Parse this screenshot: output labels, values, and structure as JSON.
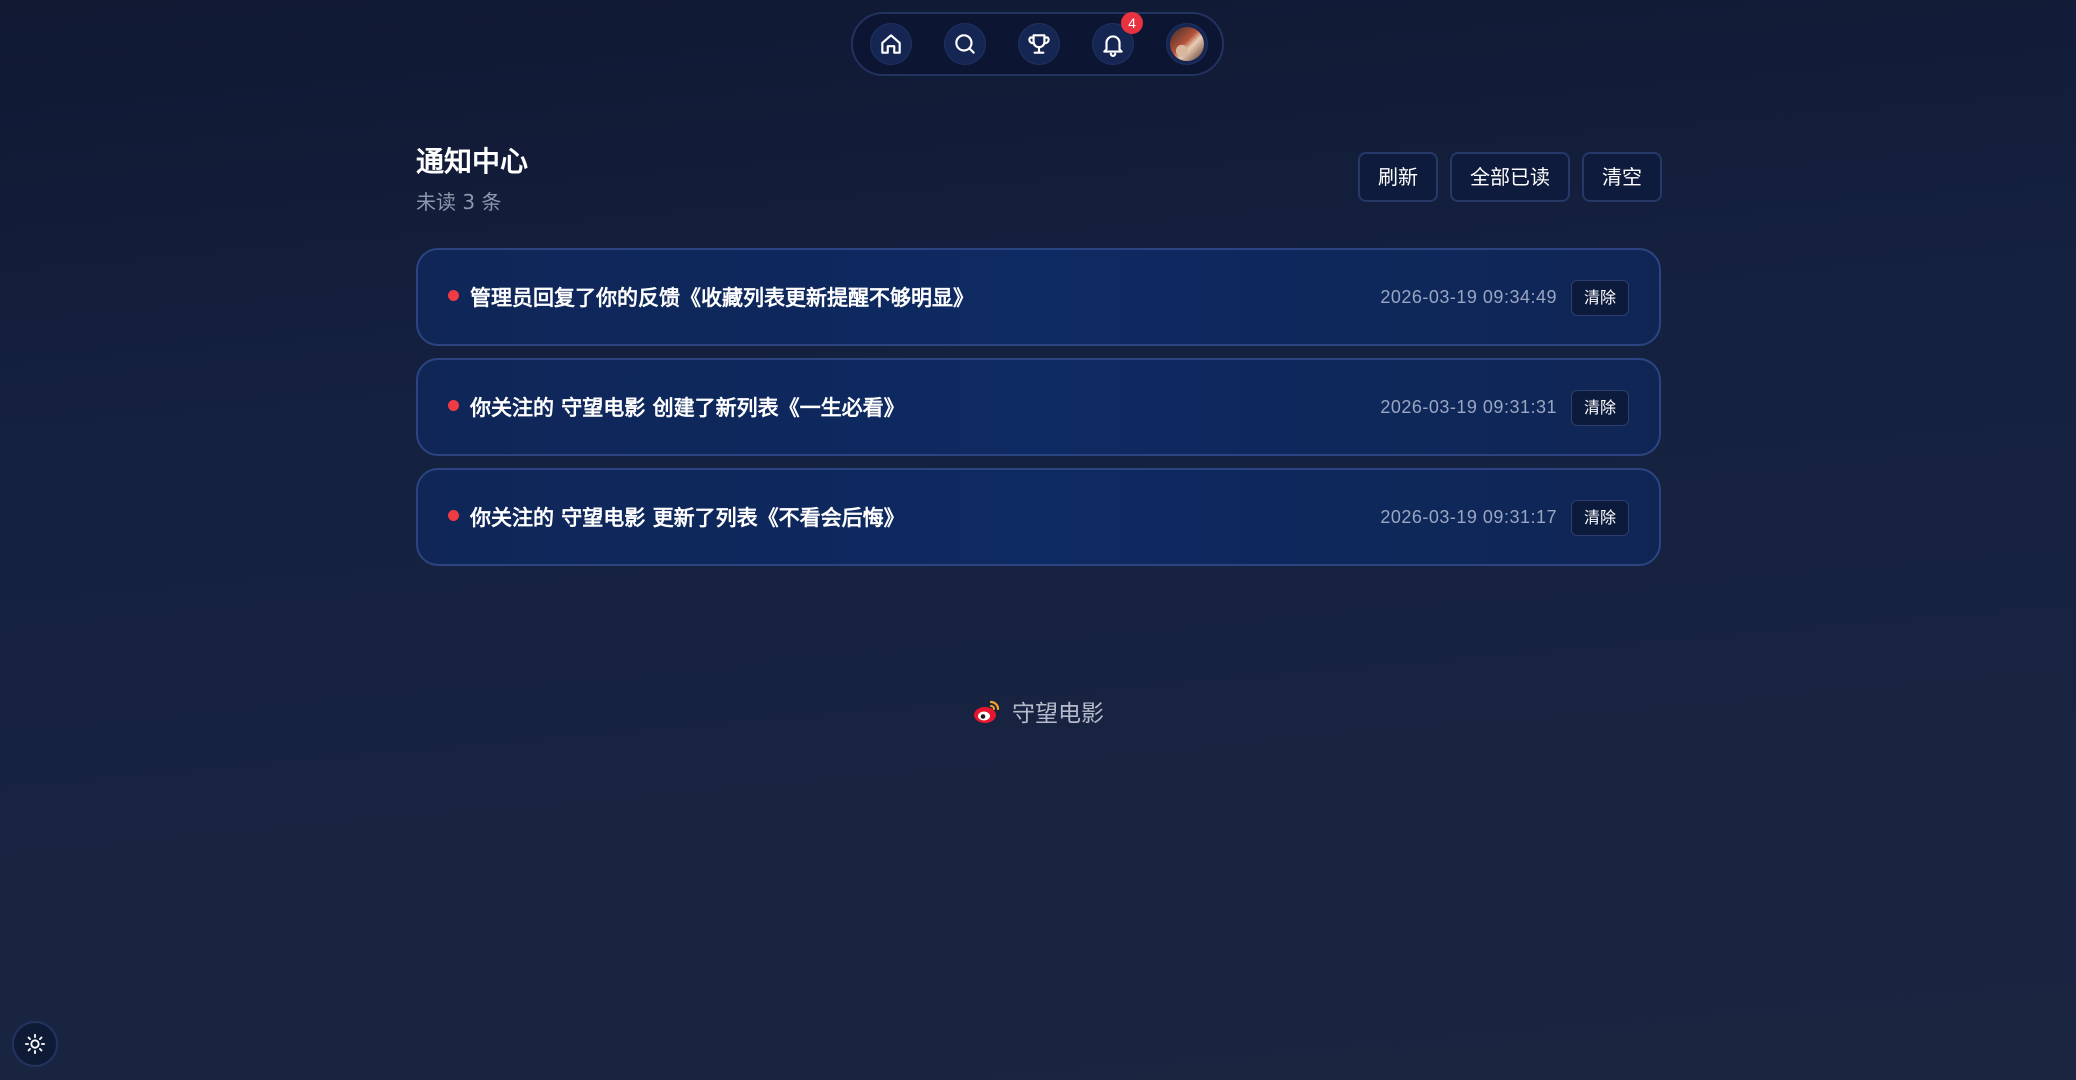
{
  "nav": {
    "items": [
      {
        "icon": "home-icon"
      },
      {
        "icon": "search-icon"
      },
      {
        "icon": "trophy-icon"
      },
      {
        "icon": "bell-icon",
        "badge": "4"
      },
      {
        "icon": "avatar"
      }
    ]
  },
  "header": {
    "title": "通知中心",
    "unread": "未读 3 条",
    "actions": {
      "refresh": "刷新",
      "mark_all_read": "全部已读",
      "clear_all": "清空"
    }
  },
  "notifications": [
    {
      "text": "管理员回复了你的反馈《收藏列表更新提醒不够明显》",
      "time": "2026-03-19 09:34:49",
      "clear": "清除",
      "unread": true
    },
    {
      "text": "你关注的 守望电影 创建了新列表《一生必看》",
      "time": "2026-03-19 09:31:31",
      "clear": "清除",
      "unread": true
    },
    {
      "text": "你关注的 守望电影 更新了列表《不看会后悔》",
      "time": "2026-03-19 09:31:17",
      "clear": "清除",
      "unread": true
    }
  ],
  "footer": {
    "brand": "守望电影",
    "icon": "weibo-icon"
  },
  "theme_toggle": {
    "icon": "sun-icon"
  },
  "colors": {
    "background": "#141f3c",
    "card": "#0f2759",
    "card_border": "#2c4482",
    "unread_dot": "#ee3b44",
    "badge": "#e8323f"
  }
}
